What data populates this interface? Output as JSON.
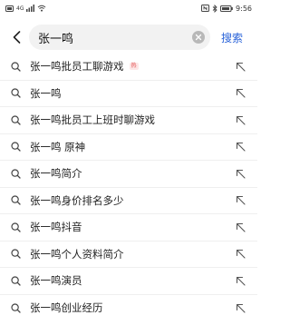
{
  "status_bar": {
    "time": "9:56",
    "network": "4G",
    "icons": [
      "sim-icon",
      "signal-icon",
      "wifi-icon",
      "nfc-icon",
      "bluetooth-icon",
      "battery-icon"
    ]
  },
  "search": {
    "value": "张一鸣",
    "action_label": "搜索"
  },
  "suggestions": [
    {
      "text": "张一鸣批员工聊游戏",
      "badge": "热"
    },
    {
      "text": "张一鸣"
    },
    {
      "text": "张一鸣批员工上班时聊游戏"
    },
    {
      "text": "张一鸣 原神"
    },
    {
      "text": "张一鸣简介"
    },
    {
      "text": "张一鸣身价排名多少"
    },
    {
      "text": "张一鸣抖音"
    },
    {
      "text": "张一鸣个人资料简介"
    },
    {
      "text": "张一鸣演员"
    },
    {
      "text": "张一鸣创业经历"
    }
  ],
  "colors": {
    "accent": "#2a63d9",
    "hot_badge": "#e24a4a"
  }
}
